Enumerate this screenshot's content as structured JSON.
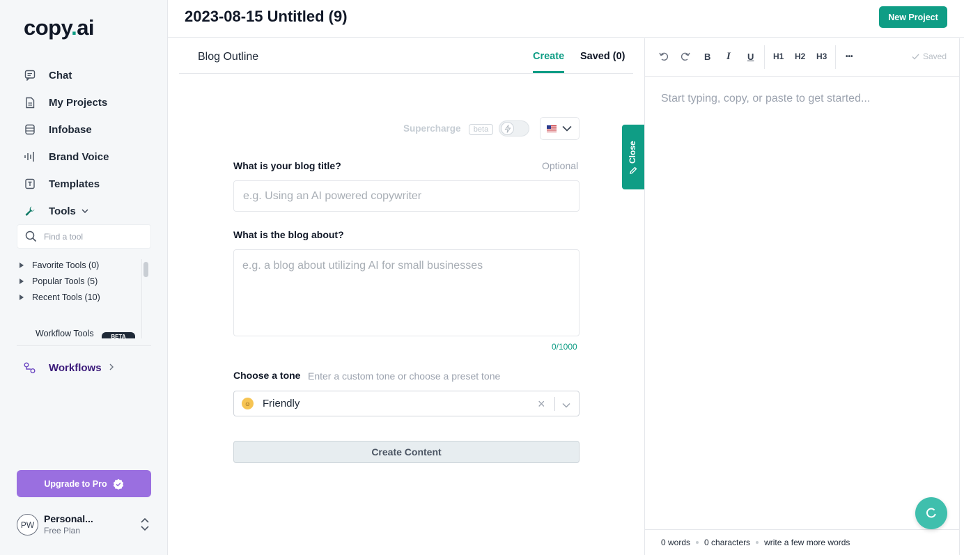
{
  "app": {
    "logo_main": "copy",
    "logo_dot": ".",
    "logo_suffix": "ai"
  },
  "colors": {
    "accent": "#0f9d85",
    "upgrade": "#9a6fe0",
    "workflows": "#3b1a7a"
  },
  "sidebar": {
    "items": [
      {
        "label": "Chat",
        "icon": "chat-icon"
      },
      {
        "label": "My Projects",
        "icon": "document-icon"
      },
      {
        "label": "Infobase",
        "icon": "database-icon"
      },
      {
        "label": "Brand Voice",
        "icon": "soundwave-icon"
      },
      {
        "label": "Templates",
        "icon": "template-icon"
      },
      {
        "label": "Tools",
        "icon": "wrench-icon"
      }
    ],
    "search_placeholder": "Find a tool",
    "tool_groups": [
      "Favorite Tools (0)",
      "Popular Tools (5)",
      "Recent Tools (10)"
    ],
    "workflow_tools": "Workflow Tools",
    "workflow_tools_badge": "BETA",
    "workflows": "Workflows",
    "upgrade": "Upgrade to Pro",
    "account": {
      "initials": "PW",
      "name": "Personal...",
      "plan": "Free Plan"
    }
  },
  "header": {
    "title": "2023-08-15 Untitled (9)",
    "new_project": "New Project"
  },
  "tool": {
    "title": "Blog Outline",
    "tabs": {
      "create": "Create",
      "saved": "Saved (0)"
    },
    "supercharge": "Supercharge",
    "beta": "beta",
    "q1_label": "What is your blog title?",
    "q1_optional": "Optional",
    "q1_placeholder": "e.g. Using an AI powered copywriter",
    "q2_label": "What is the blog about?",
    "q2_placeholder": "e.g. a blog about utilizing AI for small businesses",
    "q2_counter": "0/1000",
    "tone_label": "Choose a tone",
    "tone_hint": "Enter a custom tone or choose a preset tone",
    "tone_value": "Friendly",
    "create_button": "Create Content",
    "close_tab": "Close"
  },
  "editor": {
    "toolbar": {
      "bold": "B",
      "italic": "I",
      "underline": "U",
      "h1": "H1",
      "h2": "H2",
      "h3": "H3",
      "more": "•••",
      "saved": "Saved"
    },
    "placeholder": "Start typing, copy, or paste to get started...",
    "footer": {
      "words": "0 words",
      "characters": "0 characters",
      "hint": "write a few more words"
    }
  }
}
